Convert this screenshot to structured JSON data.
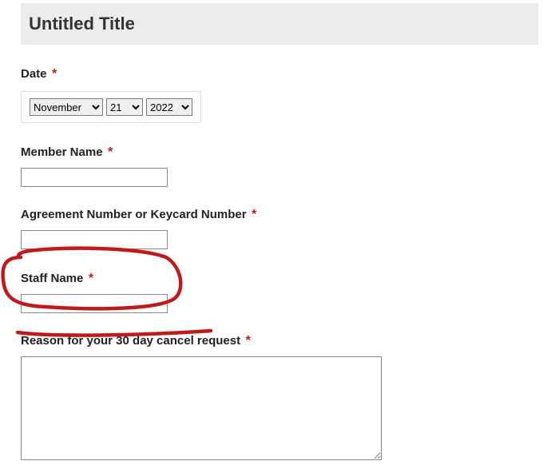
{
  "title": "Untitled Title",
  "fields": {
    "date": {
      "label": "Date",
      "required": "*",
      "month": "November",
      "day": "21",
      "year": "2022"
    },
    "member_name": {
      "label": "Member Name",
      "required": "*",
      "value": ""
    },
    "agreement": {
      "label": "Agreement Number or Keycard Number",
      "required": "*",
      "value": ""
    },
    "staff_name": {
      "label": "Staff Name",
      "required": "*",
      "value": ""
    },
    "reason": {
      "label": "Reason for your 30 day cancel request",
      "required": "*",
      "value": ""
    }
  },
  "annotation_color": "#c01b1b"
}
